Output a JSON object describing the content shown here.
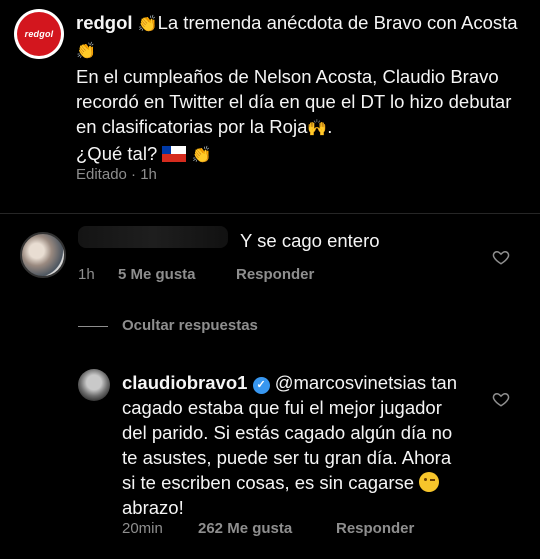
{
  "post": {
    "avatar_text": "redgol",
    "username": "redgol",
    "clap": "👏",
    "line1": "La tremenda anécdota de Bravo con Acosta",
    "body": "En el cumpleaños de Nelson Acosta, Claudio Bravo recordó en Twitter el día en que el DT lo hizo debutar en clasificatorias por la Roja",
    "raised_hands": "🙌",
    "body_end": ".",
    "question": "¿Qué tal?",
    "meta": "Editado · 1h"
  },
  "comment1": {
    "text": "Y se cago entero",
    "time": "1h",
    "likes": "5 Me gusta",
    "reply": "Responder"
  },
  "thread": {
    "hide_replies": "Ocultar respuestas"
  },
  "reply": {
    "username": "claudiobravo1",
    "mention": "@marcosvinetsias",
    "text": "tan cagado estaba que fui el mejor jugador del parido. Si estás cagado algún día no te asustes, puede ser tu gran día. Ahora si te escriben cosas, es sin cagarse",
    "text_end": "abrazo!",
    "time": "20min",
    "likes": "262 Me gusta",
    "reply_btn": "Responder"
  },
  "colors": {
    "background": "#000000",
    "text": "#f5f5f5",
    "muted": "#8e8e8e",
    "verified": "#3897f0",
    "brand": "#d3161e"
  }
}
